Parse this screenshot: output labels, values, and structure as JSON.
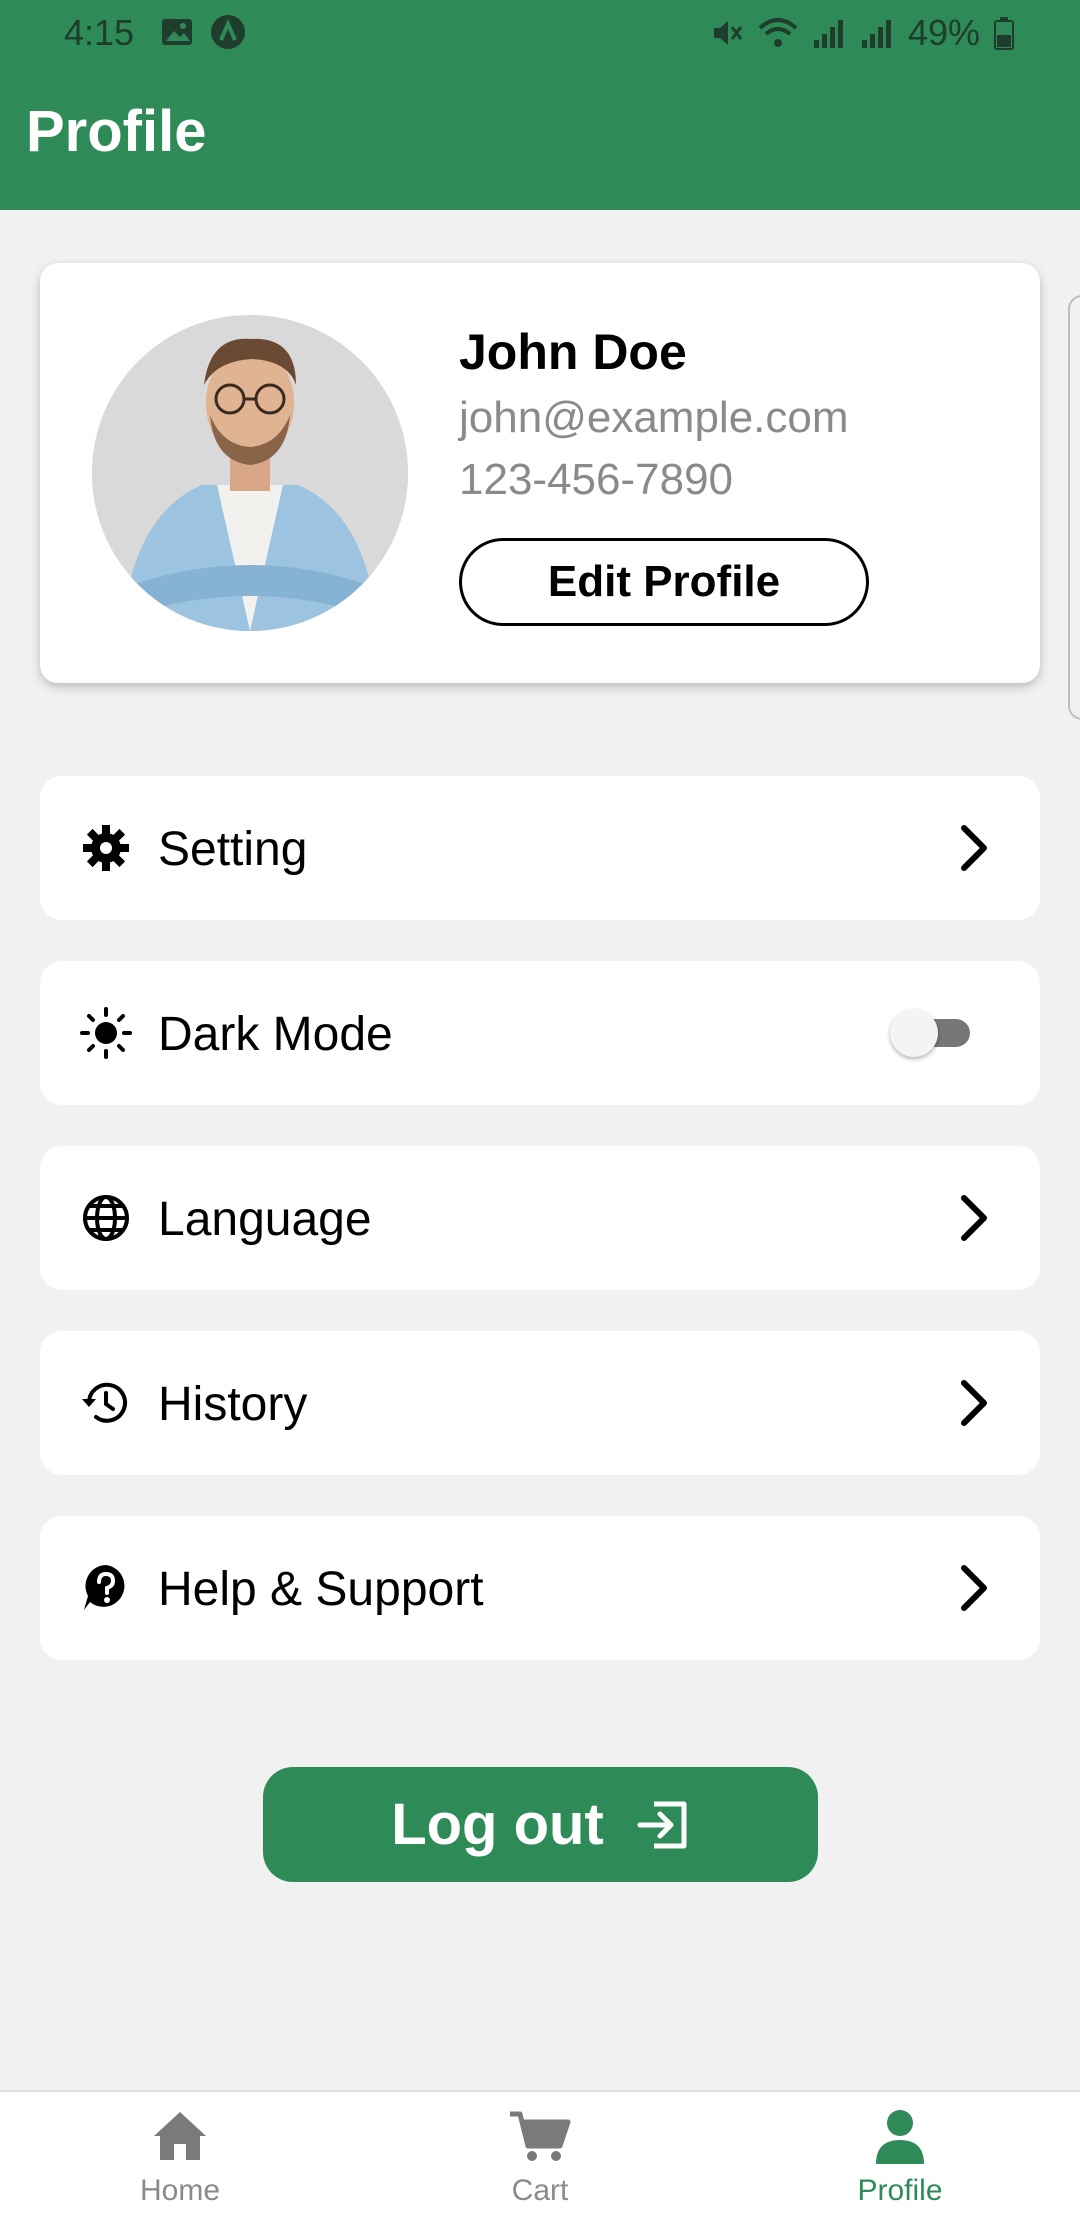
{
  "status_bar": {
    "time": "4:15",
    "battery": "49%"
  },
  "header": {
    "title": "Profile"
  },
  "profile": {
    "name": "John Doe",
    "email": "john@example.com",
    "phone": "123-456-7890",
    "edit_label": "Edit Profile"
  },
  "menu": {
    "items": [
      {
        "label": "Setting",
        "icon": "gear-icon"
      },
      {
        "label": "Dark Mode",
        "icon": "sun-icon",
        "toggle": false
      },
      {
        "label": "Language",
        "icon": "globe-icon"
      },
      {
        "label": "History",
        "icon": "history-icon"
      },
      {
        "label": "Help & Support",
        "icon": "help-icon"
      }
    ]
  },
  "logout": {
    "label": "Log out"
  },
  "bottom_nav": {
    "items": [
      {
        "label": "Home",
        "icon": "home-icon"
      },
      {
        "label": "Cart",
        "icon": "cart-icon"
      },
      {
        "label": "Profile",
        "icon": "person-icon",
        "active": true
      }
    ]
  },
  "colors": {
    "primary": "#2e8b57",
    "background": "#f1f1f1",
    "muted": "#8a8a8a"
  }
}
